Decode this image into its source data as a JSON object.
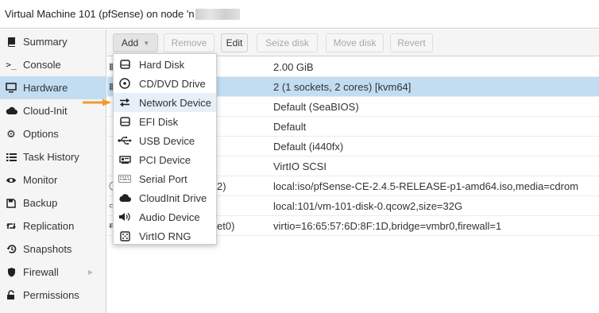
{
  "title": {
    "prefix": "Virtual Machine 101 (pfSense) on node 'n"
  },
  "sidebar": {
    "items": [
      {
        "label": "Summary",
        "icon": "book-icon"
      },
      {
        "label": "Console",
        "icon": "terminal-icon"
      },
      {
        "label": "Hardware",
        "icon": "monitor-icon",
        "active": true
      },
      {
        "label": "Cloud-Init",
        "icon": "cloud-icon"
      },
      {
        "label": "Options",
        "icon": "gear-icon"
      },
      {
        "label": "Task History",
        "icon": "list-icon"
      },
      {
        "label": "Monitor",
        "icon": "eye-icon"
      },
      {
        "label": "Backup",
        "icon": "floppy-icon"
      },
      {
        "label": "Replication",
        "icon": "retweet-icon"
      },
      {
        "label": "Snapshots",
        "icon": "history-icon"
      },
      {
        "label": "Firewall",
        "icon": "shield-icon"
      },
      {
        "label": "Permissions",
        "icon": "unlock-icon"
      }
    ]
  },
  "toolbar": {
    "add": "Add",
    "remove": "Remove",
    "edit": "Edit",
    "resize_disk": "Seize disk",
    "move_disk": "Move disk",
    "revert": "Revert"
  },
  "grid": {
    "rows": [
      {
        "key": "",
        "value": "2.00 GiB"
      },
      {
        "key": "",
        "value": "2 (1 sockets, 2 cores) [kvm64]",
        "selected": true
      },
      {
        "key": "",
        "value": "Default (SeaBIOS)"
      },
      {
        "key": "",
        "value": "Default"
      },
      {
        "key": "",
        "value": "Default (i440fx)"
      },
      {
        "key": "",
        "value": "VirtIO SCSI"
      },
      {
        "key": "2)",
        "value": "local:iso/pfSense-CE-2.4.5-RELEASE-p1-amd64.iso,media=cdrom"
      },
      {
        "key": "",
        "value": "local:101/vm-101-disk-0.qcow2,size=32G"
      },
      {
        "key": "et0)",
        "value": "virtio=16:65:57:6D:8F:1D,bridge=vmbr0,firewall=1"
      }
    ]
  },
  "add_menu": {
    "items": [
      {
        "label": "Hard Disk",
        "icon": "hdd-icon"
      },
      {
        "label": "CD/DVD Drive",
        "icon": "disc-icon"
      },
      {
        "label": "Network Device",
        "icon": "exchange-icon",
        "hover": true
      },
      {
        "label": "EFI Disk",
        "icon": "hdd-icon"
      },
      {
        "label": "USB Device",
        "icon": "usb-icon"
      },
      {
        "label": "PCI Device",
        "icon": "pci-card-icon"
      },
      {
        "label": "Serial Port",
        "icon": "keyboard-icon"
      },
      {
        "label": "CloudInit Drive",
        "icon": "cloud-icon"
      },
      {
        "label": "Audio Device",
        "icon": "volume-icon"
      },
      {
        "label": "VirtIO RNG",
        "icon": "dice-icon"
      }
    ]
  },
  "colors": {
    "accent_arrow": "#f39a2b",
    "selected_row": "#c2ddf2"
  }
}
